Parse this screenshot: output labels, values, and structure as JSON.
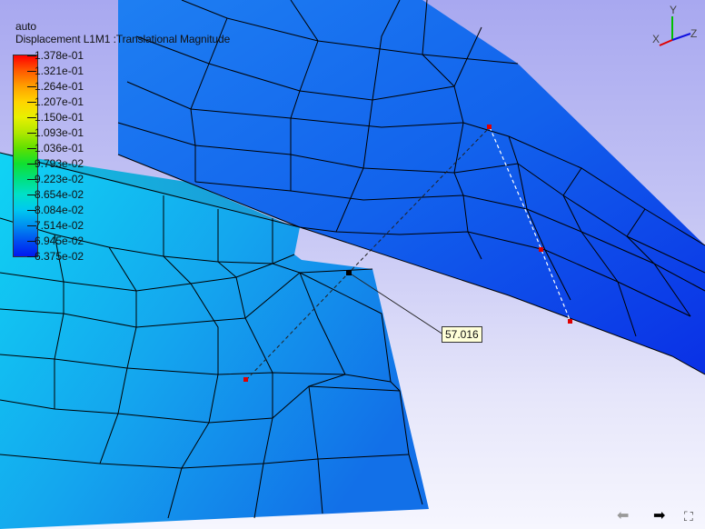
{
  "viewport": {
    "title": "auto",
    "subtitle": "Displacement L1M1 :Translational Magnitude"
  },
  "legend": {
    "labels": [
      "1.378e-01",
      "1.321e-01",
      "1.264e-01",
      "1.207e-01",
      "1.150e-01",
      "1.093e-01",
      "1.036e-01",
      "9.793e-02",
      "9.223e-02",
      "8.654e-02",
      "8.084e-02",
      "7.514e-02",
      "6.945e-02",
      "6.375e-02"
    ],
    "colors": [
      "#ff0000",
      "#ff5a00",
      "#ffa000",
      "#ffd400",
      "#e8f000",
      "#b0e800",
      "#60e000",
      "#10e030",
      "#00e080",
      "#00e0c8",
      "#00c8f0",
      "#0090f0",
      "#0050f0",
      "#0018f0"
    ]
  },
  "measurement": {
    "value": "57.016"
  },
  "axis_triad": {
    "x": "X",
    "y": "Y",
    "z": "Z",
    "colors": {
      "x": "#e00000",
      "y": "#00c000",
      "z": "#1010e0"
    }
  },
  "nav": {
    "prev_icon": "arrow-left-icon",
    "next_icon": "arrow-right-icon",
    "expand_icon": "expand-icon"
  }
}
